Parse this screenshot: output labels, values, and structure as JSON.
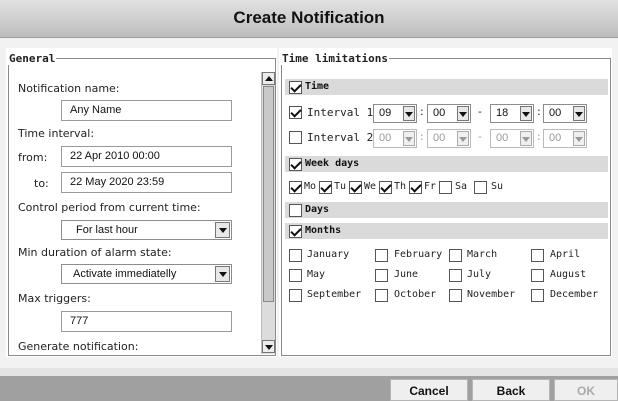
{
  "title": "Create Notification",
  "general": {
    "legend": "General",
    "notification_name_label": "Notification name:",
    "notification_name_value": "Any Name",
    "time_interval_label": "Time interval:",
    "from_label": "from:",
    "from_value": "22 Apr 2010 00:00",
    "to_label": "to:",
    "to_value": "22 May 2020 23:59",
    "control_period_label": "Control period from current time:",
    "control_period_value": "For last hour",
    "min_duration_label": "Min duration of alarm state:",
    "min_duration_value": "Activate immediatelly",
    "max_triggers_label": "Max triggers:",
    "max_triggers_value": "777",
    "generate_label": "Generate notification:"
  },
  "time_limitations": {
    "legend": "Time limitations",
    "time_section": {
      "label": "Time",
      "checked": true
    },
    "interval1": {
      "label": "Interval 1:",
      "checked": true,
      "h1": "09",
      "m1": "00",
      "h2": "18",
      "m2": "00"
    },
    "interval2": {
      "label": "Interval 2:",
      "checked": false,
      "h1": "00",
      "m1": "00",
      "h2": "00",
      "m2": "00"
    },
    "time_colon": ":",
    "time_dash": "-",
    "weekdays_section": {
      "label": "Week days",
      "checked": true
    },
    "weekdays": [
      {
        "label": "Mo",
        "checked": true
      },
      {
        "label": "Tu",
        "checked": true
      },
      {
        "label": "We",
        "checked": true
      },
      {
        "label": "Th",
        "checked": true
      },
      {
        "label": "Fr",
        "checked": true
      },
      {
        "label": "Sa",
        "checked": false
      },
      {
        "label": "Su",
        "checked": false
      }
    ],
    "days_section": {
      "label": "Days",
      "checked": false
    },
    "months_section": {
      "label": "Months",
      "checked": true
    },
    "months": [
      {
        "label": "January",
        "checked": false
      },
      {
        "label": "February",
        "checked": false
      },
      {
        "label": "March",
        "checked": false
      },
      {
        "label": "April",
        "checked": false
      },
      {
        "label": "May",
        "checked": false
      },
      {
        "label": "June",
        "checked": false
      },
      {
        "label": "July",
        "checked": false
      },
      {
        "label": "August",
        "checked": false
      },
      {
        "label": "September",
        "checked": false
      },
      {
        "label": "October",
        "checked": false
      },
      {
        "label": "November",
        "checked": false
      },
      {
        "label": "December",
        "checked": false
      }
    ]
  },
  "footer": {
    "cancel": "Cancel",
    "back": "Back",
    "ok": "OK"
  }
}
